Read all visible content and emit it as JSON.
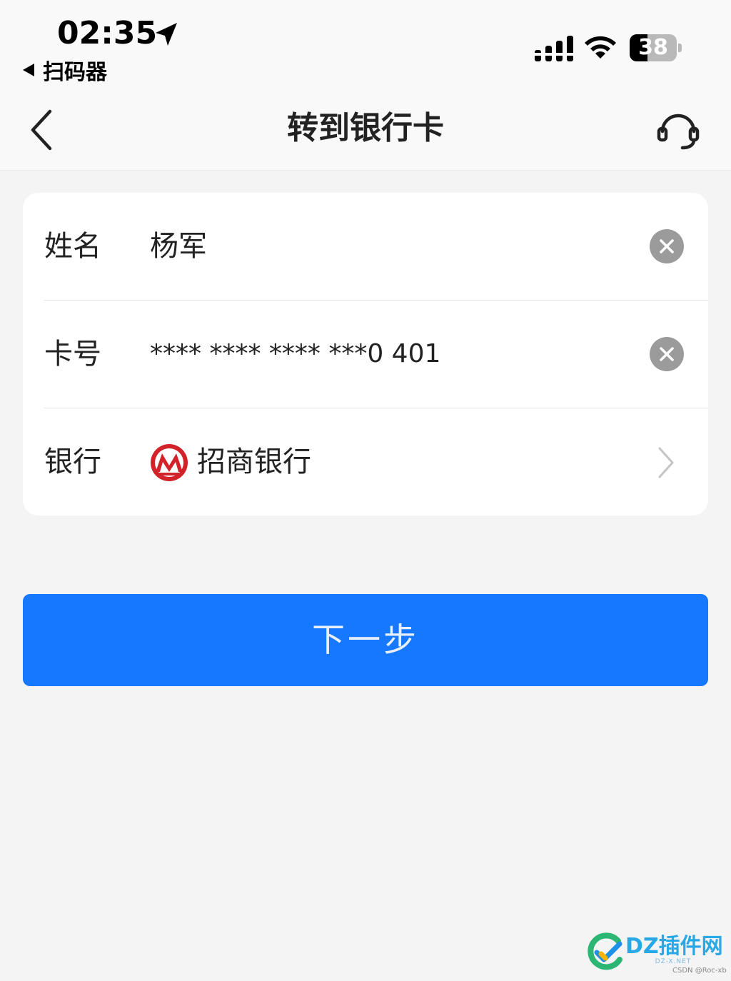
{
  "status_bar": {
    "time": "02:35",
    "back_app_label": "扫码器",
    "battery_level": "38",
    "battery_fraction": 0.38
  },
  "nav": {
    "title": "转到银行卡"
  },
  "form": {
    "name": {
      "label": "姓名",
      "value": "杨军"
    },
    "card_number": {
      "label": "卡号",
      "value": "**** **** **** ***0 401"
    },
    "bank": {
      "label": "银行",
      "value": "招商银行"
    }
  },
  "next_button": {
    "label": "下一步"
  },
  "colors": {
    "primary": "#1677ff",
    "bank_logo_red": "#d2232a",
    "clear_button": "#9b9b9b",
    "page_background": "#f4f4f4"
  },
  "icons": {
    "location": "location-arrow-icon",
    "signal": "cellular-signal-icon",
    "wifi": "wifi-icon",
    "battery": "battery-icon",
    "back": "chevron-left-icon",
    "support": "headset-icon",
    "clear": "clear-x-icon",
    "bank_logo": "cmb-bank-logo-icon",
    "forward": "chevron-right-icon"
  },
  "watermark": {
    "brand": "DZ插件网",
    "domain": "DZ-X.NET",
    "credit": "CSDN @Roc-xb"
  }
}
